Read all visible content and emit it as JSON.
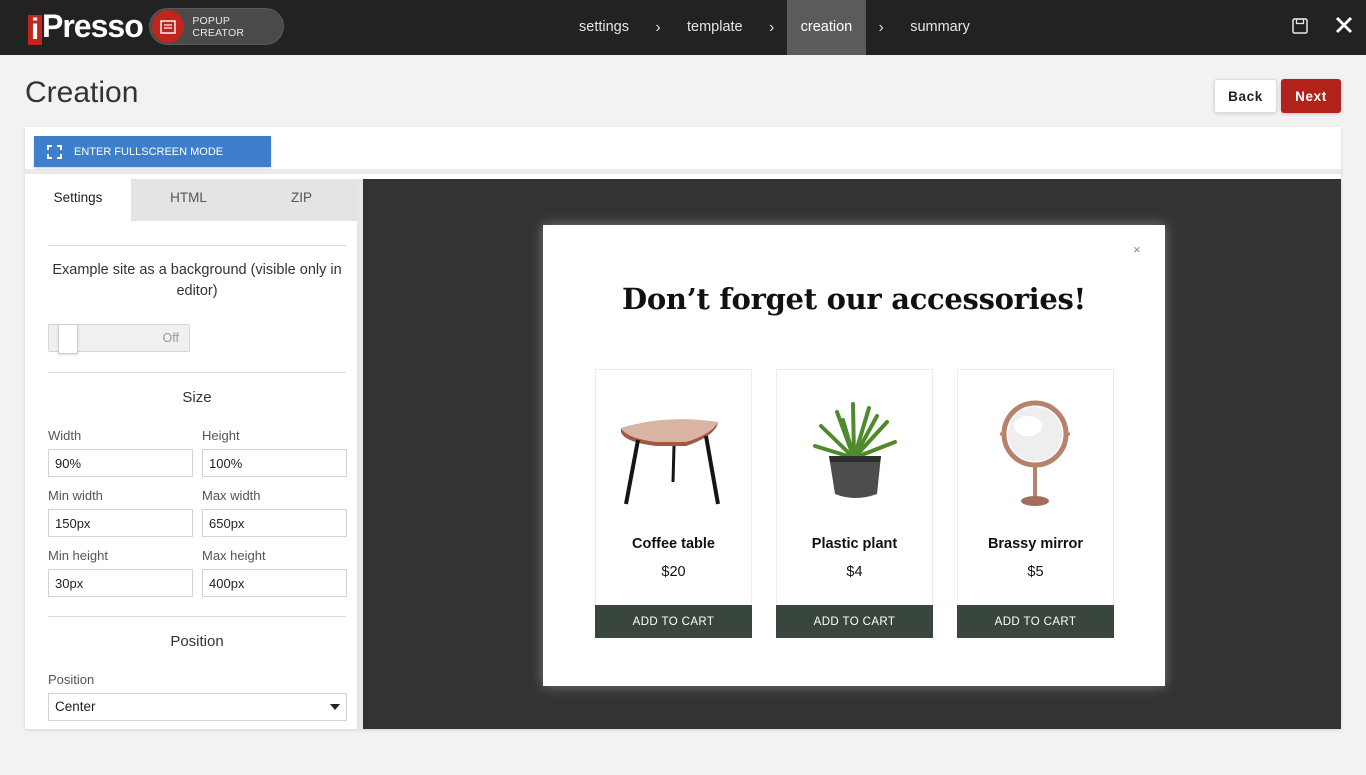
{
  "brand": {
    "logo_i": "i",
    "logo_text": "Presso",
    "product": "POPUP CREATOR",
    "accent": "#c0251e"
  },
  "steps": [
    {
      "label": "settings",
      "active": false
    },
    {
      "label": "template",
      "active": false
    },
    {
      "label": "creation",
      "active": true
    },
    {
      "label": "summary",
      "active": false
    }
  ],
  "step_separator": "›",
  "header": {
    "title": "Creation",
    "back_label": "Back",
    "next_label": "Next"
  },
  "toolbar": {
    "fullscreen_label": "ENTER FULLSCREEN MODE"
  },
  "sidebar": {
    "tabs": [
      "Settings",
      "HTML",
      "ZIP"
    ],
    "active_tab": "Settings",
    "background_label": "Example site as a background (visible only in editor)",
    "toggle_state": "Off",
    "size_title": "Size",
    "fields": {
      "width": {
        "label": "Width",
        "value": "90%"
      },
      "height": {
        "label": "Height",
        "value": "100%"
      },
      "min_width": {
        "label": "Min width",
        "value": "150px"
      },
      "max_width": {
        "label": "Max width",
        "value": "650px"
      },
      "min_height": {
        "label": "Min height",
        "value": "30px"
      },
      "max_height": {
        "label": "Max height",
        "value": "400px"
      }
    },
    "position_title": "Position",
    "position_label": "Position",
    "position_value": "Center"
  },
  "popup": {
    "close": "×",
    "title": "Don’t forget our accessories!",
    "products": [
      {
        "name": "Coffee table",
        "price": "$20",
        "cta": "ADD TO CART",
        "icon": "coffee-table-image"
      },
      {
        "name": "Plastic plant",
        "price": "$4",
        "cta": "ADD TO CART",
        "icon": "plant-image"
      },
      {
        "name": "Brassy mirror",
        "price": "$5",
        "cta": "ADD TO CART",
        "icon": "mirror-image"
      }
    ],
    "button_color": "#38463d"
  }
}
